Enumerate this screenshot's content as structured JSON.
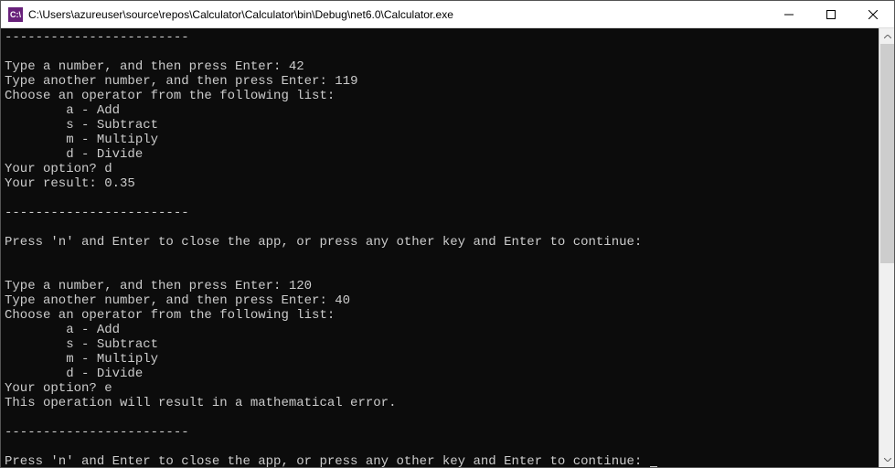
{
  "window": {
    "title": "C:\\Users\\azureuser\\source\\repos\\Calculator\\Calculator\\bin\\Debug\\net6.0\\Calculator.exe",
    "icon_label": "C:\\"
  },
  "console": {
    "separator": "------------------------",
    "run1": {
      "prompt_num1": "Type a number, and then press Enter: ",
      "input_num1": "42",
      "prompt_num2": "Type another number, and then press Enter: ",
      "input_num2": "119",
      "choose_line": "Choose an operator from the following list:",
      "opt_a": "        a - Add",
      "opt_s": "        s - Subtract",
      "opt_m": "        m - Multiply",
      "opt_d": "        d - Divide",
      "option_prompt": "Your option? ",
      "option_input": "d",
      "result_label": "Your result: ",
      "result_value": "0.35"
    },
    "continue_prompt": "Press 'n' and Enter to close the app, or press any other key and Enter to continue: ",
    "run2": {
      "prompt_num1": "Type a number, and then press Enter: ",
      "input_num1": "120",
      "prompt_num2": "Type another number, and then press Enter: ",
      "input_num2": "40",
      "choose_line": "Choose an operator from the following list:",
      "opt_a": "        a - Add",
      "opt_s": "        s - Subtract",
      "opt_m": "        m - Multiply",
      "opt_d": "        d - Divide",
      "option_prompt": "Your option? ",
      "option_input": "e",
      "error_msg": "This operation will result in a mathematical error."
    }
  }
}
